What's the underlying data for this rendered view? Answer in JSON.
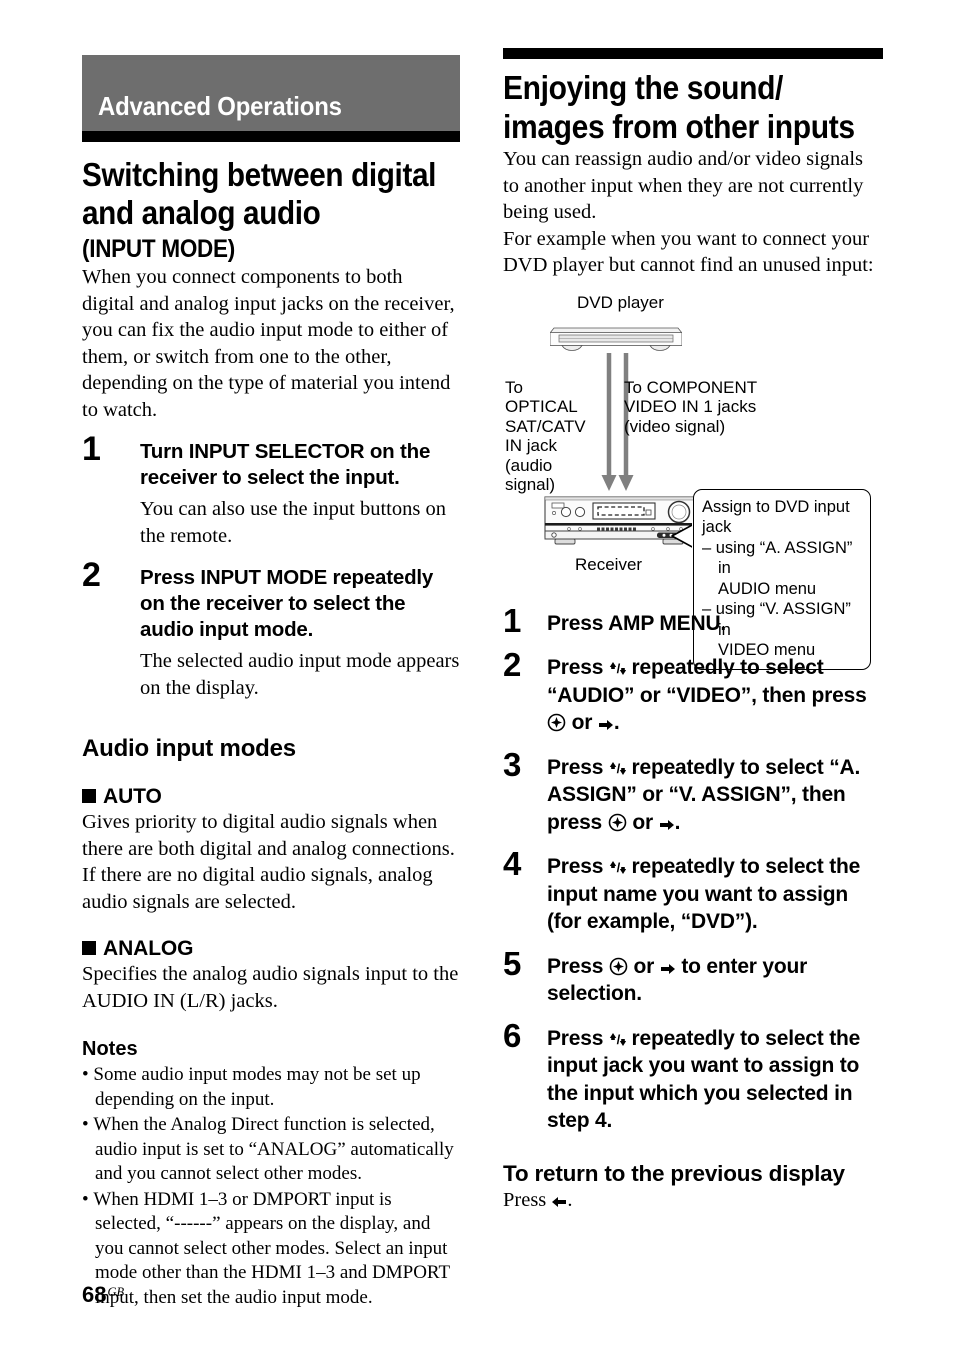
{
  "page": {
    "number": "68",
    "region_code": "GB"
  },
  "left_column": {
    "section_banner": "Advanced Operations",
    "title": "Switching between digital and analog audio",
    "subtitle": "(INPUT MODE)",
    "intro": "When you connect components to both digital and analog input jacks on the receiver, you can fix the audio input mode to either of them, or switch from one to the other, depending on the type of material you intend to watch.",
    "steps": [
      {
        "number": "1",
        "heading": "Turn INPUT SELECTOR on the receiver to select the input.",
        "body": "You can also use the input buttons on the remote."
      },
      {
        "number": "2",
        "heading": "Press INPUT MODE repeatedly on the receiver to select the audio input mode.",
        "body": "The selected audio input mode appears on the display."
      }
    ],
    "modes_heading": "Audio input modes",
    "modes": [
      {
        "name": "AUTO",
        "body": "Gives priority to digital audio signals when there are both digital and analog connections. If there are no digital audio signals, analog audio signals are selected."
      },
      {
        "name": "ANALOG",
        "body": "Specifies the analog audio signals input to the AUDIO IN (L/R) jacks."
      }
    ],
    "notes_heading": "Notes",
    "notes": [
      "Some audio input modes may not be set up depending on the input.",
      "When the Analog Direct function is selected, audio input is set to “ANALOG” automatically and you cannot select other modes.",
      "When HDMI 1–3 or DMPORT input is selected, “------” appears on the display, and you cannot select other modes. Select an input mode other than the HDMI 1–3 and DMPORT input, then set the audio input mode."
    ]
  },
  "right_column": {
    "title": "Enjoying the sound/ images from other inputs",
    "intro_1": "You can reassign audio and/or video signals to another input when they are not currently being used.",
    "intro_2": "For example when you want to connect your DVD player but cannot find an unused input:",
    "diagram": {
      "dvd_label": "DVD player",
      "left_label": "To OPTICAL SAT/CATV IN jack (audio signal)",
      "right_label": "To COMPONENT VIDEO IN 1 jacks (video signal)",
      "receiver_label": "Receiver",
      "callout": {
        "line1": "Assign to DVD input jack",
        "line2": "– using “A. ASSIGN” in",
        "line3": "AUDIO menu",
        "line4": "– using “V. ASSIGN” in",
        "line5": "VIDEO menu"
      }
    },
    "steps": [
      {
        "number": "1",
        "heading_pre": "Press AMP MENU.",
        "heading_post": ""
      },
      {
        "number": "2",
        "heading_pre": "Press ",
        "heading_mid": " repeatedly to select “AUDIO” or “VIDEO”, then press ",
        "heading_post": " or "
      },
      {
        "number": "3",
        "heading_pre": "Press ",
        "heading_mid": " repeatedly to select “A. ASSIGN” or “V. ASSIGN”, then press ",
        "heading_post": " or "
      },
      {
        "number": "4",
        "heading_pre": "Press ",
        "heading_mid": " repeatedly to select the input name you want to assign (for example, “DVD”).",
        "heading_post": ""
      },
      {
        "number": "5",
        "heading_pre": "Press ",
        "heading_mid": " or ",
        "heading_post": " to enter your selection."
      },
      {
        "number": "6",
        "heading_pre": "Press ",
        "heading_mid": " repeatedly to select the input jack you want to assign to the input which you selected in step 4.",
        "heading_post": ""
      }
    ],
    "return_heading": "To return to the previous display",
    "return_body_pre": "Press ",
    "return_body_post": "."
  },
  "colors": {
    "banner_gray": "#6e6e6e",
    "rule_black": "#000000",
    "arrow_gray": "#808080",
    "text": "#000000"
  },
  "icons": {
    "up_arrow": "⬆",
    "down_arrow": "⬇",
    "right_arrow": "⮕",
    "left_arrow": "⬅",
    "enter_button": "enter-circle-icon",
    "square_bullet": "■"
  }
}
